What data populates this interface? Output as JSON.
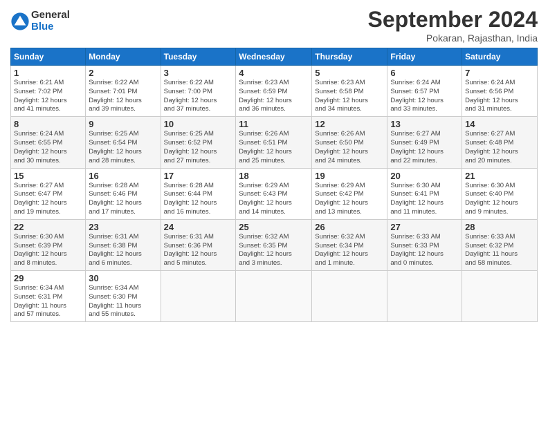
{
  "logo": {
    "text_general": "General",
    "text_blue": "Blue"
  },
  "header": {
    "title": "September 2024",
    "subtitle": "Pokaran, Rajasthan, India"
  },
  "weekdays": [
    "Sunday",
    "Monday",
    "Tuesday",
    "Wednesday",
    "Thursday",
    "Friday",
    "Saturday"
  ],
  "weeks": [
    [
      {
        "day": "1",
        "info": "Sunrise: 6:21 AM\nSunset: 7:02 PM\nDaylight: 12 hours\nand 41 minutes."
      },
      {
        "day": "2",
        "info": "Sunrise: 6:22 AM\nSunset: 7:01 PM\nDaylight: 12 hours\nand 39 minutes."
      },
      {
        "day": "3",
        "info": "Sunrise: 6:22 AM\nSunset: 7:00 PM\nDaylight: 12 hours\nand 37 minutes."
      },
      {
        "day": "4",
        "info": "Sunrise: 6:23 AM\nSunset: 6:59 PM\nDaylight: 12 hours\nand 36 minutes."
      },
      {
        "day": "5",
        "info": "Sunrise: 6:23 AM\nSunset: 6:58 PM\nDaylight: 12 hours\nand 34 minutes."
      },
      {
        "day": "6",
        "info": "Sunrise: 6:24 AM\nSunset: 6:57 PM\nDaylight: 12 hours\nand 33 minutes."
      },
      {
        "day": "7",
        "info": "Sunrise: 6:24 AM\nSunset: 6:56 PM\nDaylight: 12 hours\nand 31 minutes."
      }
    ],
    [
      {
        "day": "8",
        "info": "Sunrise: 6:24 AM\nSunset: 6:55 PM\nDaylight: 12 hours\nand 30 minutes."
      },
      {
        "day": "9",
        "info": "Sunrise: 6:25 AM\nSunset: 6:54 PM\nDaylight: 12 hours\nand 28 minutes."
      },
      {
        "day": "10",
        "info": "Sunrise: 6:25 AM\nSunset: 6:52 PM\nDaylight: 12 hours\nand 27 minutes."
      },
      {
        "day": "11",
        "info": "Sunrise: 6:26 AM\nSunset: 6:51 PM\nDaylight: 12 hours\nand 25 minutes."
      },
      {
        "day": "12",
        "info": "Sunrise: 6:26 AM\nSunset: 6:50 PM\nDaylight: 12 hours\nand 24 minutes."
      },
      {
        "day": "13",
        "info": "Sunrise: 6:27 AM\nSunset: 6:49 PM\nDaylight: 12 hours\nand 22 minutes."
      },
      {
        "day": "14",
        "info": "Sunrise: 6:27 AM\nSunset: 6:48 PM\nDaylight: 12 hours\nand 20 minutes."
      }
    ],
    [
      {
        "day": "15",
        "info": "Sunrise: 6:27 AM\nSunset: 6:47 PM\nDaylight: 12 hours\nand 19 minutes."
      },
      {
        "day": "16",
        "info": "Sunrise: 6:28 AM\nSunset: 6:46 PM\nDaylight: 12 hours\nand 17 minutes."
      },
      {
        "day": "17",
        "info": "Sunrise: 6:28 AM\nSunset: 6:44 PM\nDaylight: 12 hours\nand 16 minutes."
      },
      {
        "day": "18",
        "info": "Sunrise: 6:29 AM\nSunset: 6:43 PM\nDaylight: 12 hours\nand 14 minutes."
      },
      {
        "day": "19",
        "info": "Sunrise: 6:29 AM\nSunset: 6:42 PM\nDaylight: 12 hours\nand 13 minutes."
      },
      {
        "day": "20",
        "info": "Sunrise: 6:30 AM\nSunset: 6:41 PM\nDaylight: 12 hours\nand 11 minutes."
      },
      {
        "day": "21",
        "info": "Sunrise: 6:30 AM\nSunset: 6:40 PM\nDaylight: 12 hours\nand 9 minutes."
      }
    ],
    [
      {
        "day": "22",
        "info": "Sunrise: 6:30 AM\nSunset: 6:39 PM\nDaylight: 12 hours\nand 8 minutes."
      },
      {
        "day": "23",
        "info": "Sunrise: 6:31 AM\nSunset: 6:38 PM\nDaylight: 12 hours\nand 6 minutes."
      },
      {
        "day": "24",
        "info": "Sunrise: 6:31 AM\nSunset: 6:36 PM\nDaylight: 12 hours\nand 5 minutes."
      },
      {
        "day": "25",
        "info": "Sunrise: 6:32 AM\nSunset: 6:35 PM\nDaylight: 12 hours\nand 3 minutes."
      },
      {
        "day": "26",
        "info": "Sunrise: 6:32 AM\nSunset: 6:34 PM\nDaylight: 12 hours\nand 1 minute."
      },
      {
        "day": "27",
        "info": "Sunrise: 6:33 AM\nSunset: 6:33 PM\nDaylight: 12 hours\nand 0 minutes."
      },
      {
        "day": "28",
        "info": "Sunrise: 6:33 AM\nSunset: 6:32 PM\nDaylight: 11 hours\nand 58 minutes."
      }
    ],
    [
      {
        "day": "29",
        "info": "Sunrise: 6:34 AM\nSunset: 6:31 PM\nDaylight: 11 hours\nand 57 minutes."
      },
      {
        "day": "30",
        "info": "Sunrise: 6:34 AM\nSunset: 6:30 PM\nDaylight: 11 hours\nand 55 minutes."
      },
      {
        "day": "",
        "info": ""
      },
      {
        "day": "",
        "info": ""
      },
      {
        "day": "",
        "info": ""
      },
      {
        "day": "",
        "info": ""
      },
      {
        "day": "",
        "info": ""
      }
    ]
  ]
}
